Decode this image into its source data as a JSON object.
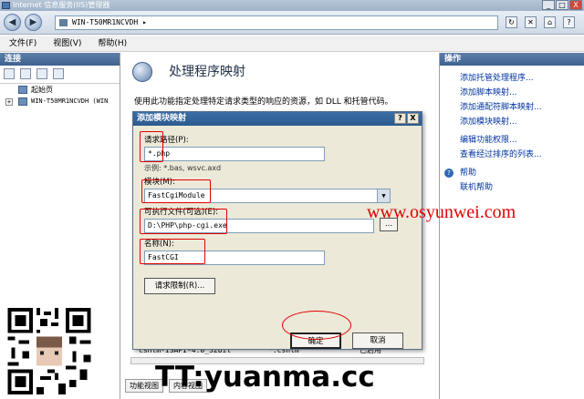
{
  "window": {
    "title": "Internet 信息服务(IIS)管理器",
    "controls": [
      "_",
      "□",
      "X"
    ]
  },
  "address": {
    "path": "WIN-T50MR1NCVDH ▸"
  },
  "menu": [
    "文件(F)",
    "视图(V)",
    "帮助(H)"
  ],
  "left": {
    "title": "连接",
    "tree": [
      {
        "label": "起始页"
      },
      {
        "label": "WIN-T50MR1NCVDH (WIN"
      }
    ]
  },
  "center": {
    "title": "处理程序映射",
    "description": "使用此功能指定处理特定请求类型的响应的资源，如 DLL 和托管代码。",
    "list_row": {
      "c1": "cshtm-ISAPI-4.0_32bit",
      "c2": "*.cshtm",
      "c3": "已启用"
    },
    "tabs": [
      "功能视图",
      "内容视图"
    ]
  },
  "right": {
    "title": "操作",
    "actions": [
      "添加托管处理程序...",
      "添加脚本映射...",
      "添加通配符脚本映射...",
      "添加模块映射...",
      "编辑功能权限...",
      "查看经过排序的列表..."
    ],
    "help": [
      "帮助",
      "联机帮助"
    ]
  },
  "dialog": {
    "title": "添加模块映射",
    "controls": [
      "?",
      "X"
    ],
    "path_label": "请求路径(P):",
    "path_value": "*.php",
    "example": "示例: *.bas, wsvc.axd",
    "module_label": "模块(M):",
    "module_value": "FastCgiModule",
    "exe_label": "可执行文件(可选)(E):",
    "exe_value": "D:\\PHP\\php-cgi.exe",
    "browse": "...",
    "name_label": "名称(N):",
    "name_value": "FastCGI",
    "limit_button": "请求限制(R)...",
    "ok": "确定",
    "cancel": "取消"
  },
  "watermarks": {
    "site": "www.osyunwei.com",
    "tt": "TT:yuanma.cc"
  }
}
